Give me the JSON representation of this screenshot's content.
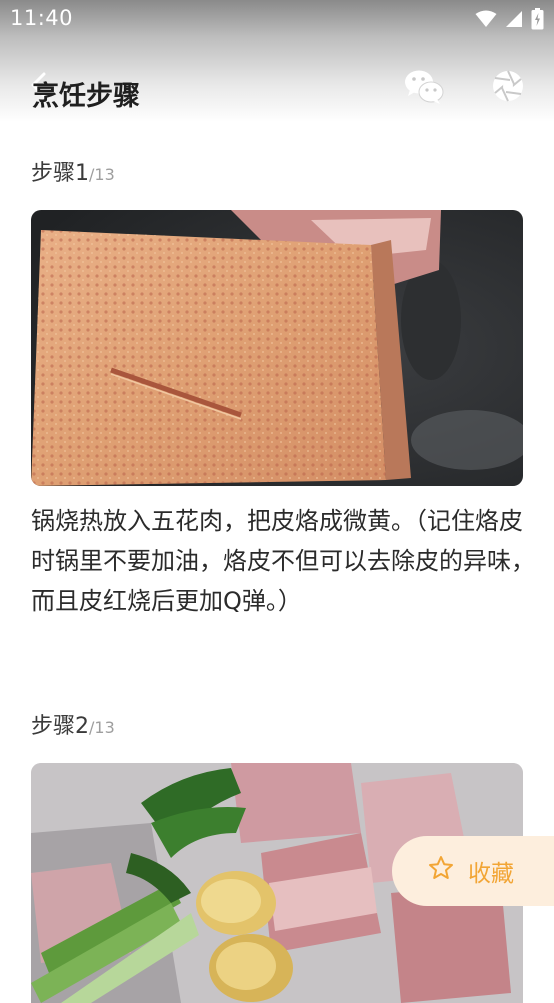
{
  "status_bar": {
    "time": "11:40"
  },
  "toolbar": {
    "title": "烹饪步骤"
  },
  "steps": [
    {
      "label": "步骤1",
      "total": "/13",
      "text": "锅烧热放入五花肉，把皮烙成微黄。（记住烙皮时锅里不要加油，烙皮不但可以去除皮的异味，而且皮红烧后更加Q弹。）"
    },
    {
      "label": "步骤2",
      "total": "/13"
    }
  ],
  "favorite": {
    "label": "收藏"
  },
  "colors": {
    "accent": "#f2a535",
    "fav_bg": "#fdeedd"
  }
}
